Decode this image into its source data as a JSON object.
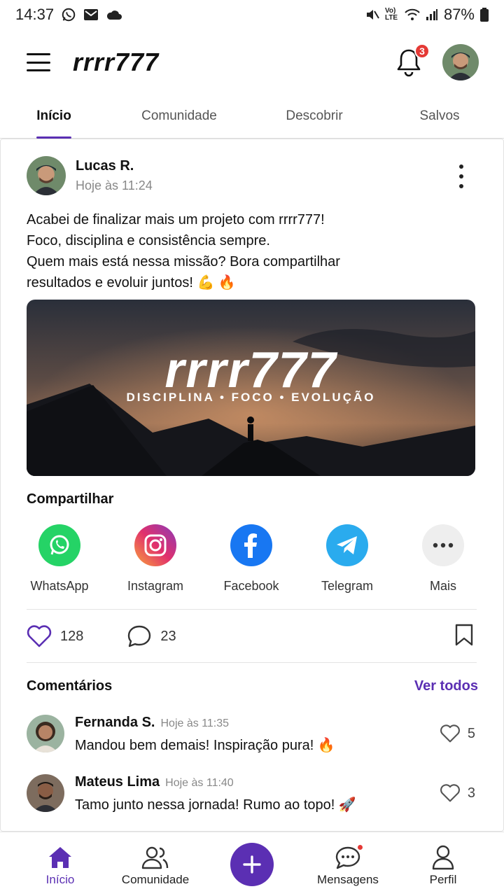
{
  "status_bar": {
    "time": "14:37",
    "battery": "87%",
    "network": "Vo) LTE"
  },
  "header": {
    "brand": "rrrr777",
    "notification_count": "3"
  },
  "tabs": [
    {
      "label": "Início",
      "active": true
    },
    {
      "label": "Comunidade",
      "active": false
    },
    {
      "label": "Descobrir",
      "active": false
    },
    {
      "label": "Salvos",
      "active": false
    }
  ],
  "post": {
    "author": "Lucas R.",
    "time": "Hoje às 11:24",
    "text_lines": [
      "Acabei de finalizar mais um projeto com rrrr777!",
      "Foco, disciplina e consistência sempre.",
      "Quem mais está nessa missão? Bora compartilhar",
      "resultados e evoluir juntos! 💪 🔥"
    ],
    "image": {
      "title": "rrrr777",
      "subtitle": "DISCIPLINA • FOCO • EVOLUÇÃO"
    },
    "likes": "128",
    "comments_count": "23"
  },
  "share": {
    "title": "Compartilhar",
    "items": [
      {
        "label": "WhatsApp",
        "icon": "whatsapp-icon",
        "color": "#25D366"
      },
      {
        "label": "Instagram",
        "icon": "instagram-icon",
        "color": "#E1306C"
      },
      {
        "label": "Facebook",
        "icon": "facebook-icon",
        "color": "#1877F2"
      },
      {
        "label": "Telegram",
        "icon": "telegram-icon",
        "color": "#2AABEE"
      },
      {
        "label": "Mais",
        "icon": "more-icon",
        "color": "#EEEEEE"
      }
    ]
  },
  "comments": {
    "title": "Comentários",
    "see_all": "Ver todos",
    "items": [
      {
        "name": "Fernanda S.",
        "time": "Hoje às 11:35",
        "text": "Mandou bem demais! Inspiração pura! 🔥",
        "likes": "5"
      },
      {
        "name": "Mateus Lima",
        "time": "Hoje às 11:40",
        "text": "Tamo junto nessa jornada! Rumo ao topo! 🚀",
        "likes": "3"
      }
    ]
  },
  "bottom_nav": {
    "items": [
      {
        "label": "Início",
        "active": true
      },
      {
        "label": "Comunidade",
        "active": false
      },
      {
        "label": "Mensagens",
        "active": false
      },
      {
        "label": "Perfil",
        "active": false
      }
    ]
  },
  "colors": {
    "accent": "#5b2fb3",
    "badge": "#e53935"
  }
}
